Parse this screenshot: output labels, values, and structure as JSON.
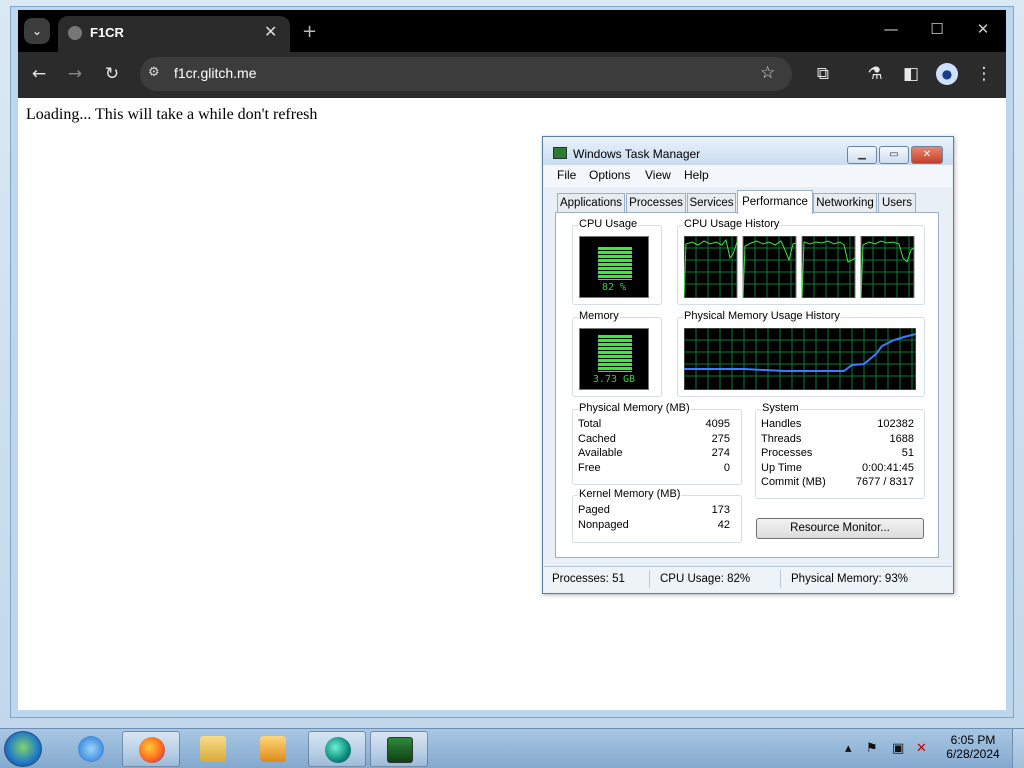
{
  "browser": {
    "tab_title": "F1CR",
    "url": "f1cr.glitch.me",
    "page_text": "Loading... This will take a while don't refresh"
  },
  "icons": {
    "tab_search": "chevron-down-icon",
    "tab_close": "close-icon",
    "new_tab": "plus-icon",
    "back": "back-arrow-icon",
    "forward": "forward-arrow-icon",
    "reload": "reload-icon",
    "site_info": "tune-icon",
    "bookmark": "star-icon",
    "extensions": "puzzle-icon",
    "labs": "flask-icon",
    "side_panel": "side-panel-icon",
    "profile": "profile-icon",
    "menu": "kebab-menu-icon"
  },
  "task_manager": {
    "title": "Windows Task Manager",
    "menu": [
      "File",
      "Options",
      "View",
      "Help"
    ],
    "tabs": [
      "Applications",
      "Processes",
      "Services",
      "Performance",
      "Networking",
      "Users"
    ],
    "active_tab": "Performance",
    "cpu_usage_label": "CPU Usage",
    "cpu_usage_value": "82 %",
    "cpu_history_label": "CPU Usage History",
    "memory_label": "Memory",
    "memory_value": "3.73 GB",
    "mem_history_label": "Physical Memory Usage History",
    "physical_memory": {
      "label": "Physical Memory (MB)",
      "rows": [
        {
          "k": "Total",
          "v": "4095"
        },
        {
          "k": "Cached",
          "v": "275"
        },
        {
          "k": "Available",
          "v": "274"
        },
        {
          "k": "Free",
          "v": "0"
        }
      ]
    },
    "kernel_memory": {
      "label": "Kernel Memory (MB)",
      "rows": [
        {
          "k": "Paged",
          "v": "173"
        },
        {
          "k": "Nonpaged",
          "v": "42"
        }
      ]
    },
    "system": {
      "label": "System",
      "rows": [
        {
          "k": "Handles",
          "v": "102382"
        },
        {
          "k": "Threads",
          "v": "1688"
        },
        {
          "k": "Processes",
          "v": "51"
        },
        {
          "k": "Up Time",
          "v": "0:00:41:45"
        },
        {
          "k": "Commit (MB)",
          "v": "7677 / 8317"
        }
      ]
    },
    "resource_monitor_label": "Resource Monitor...",
    "status": {
      "processes": "Processes: 51",
      "cpu": "CPU Usage: 82%",
      "memory": "Physical Memory: 93%"
    },
    "cpu_percent": 82,
    "memory_percent": 93
  },
  "taskbar": {
    "time": "6:05 PM",
    "date": "6/28/2024",
    "apps": [
      "internet-explorer",
      "firefox",
      "windows-explorer",
      "media-player",
      "app-teal",
      "task-manager"
    ]
  }
}
